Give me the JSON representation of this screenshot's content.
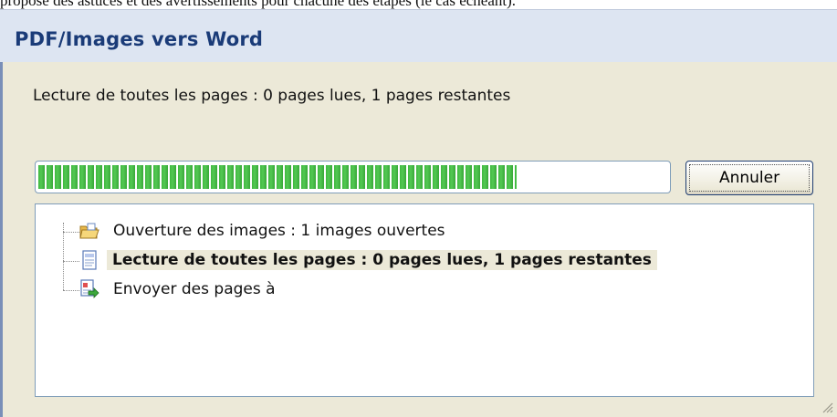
{
  "caption": {
    "text": "propose des astuces et des avertissements pour chacune des étapes (le cas échéant)."
  },
  "window": {
    "title": "PDF/Images vers Word",
    "status": "Lecture de toutes les pages : 0 pages lues, 1 pages restantes",
    "progress": 0.76,
    "cancel_label": "Annuler"
  },
  "tree": {
    "items": [
      {
        "label": "Ouverture des images : 1 images ouvertes",
        "icon": "folder-open-icon",
        "selected": false
      },
      {
        "label": "Lecture de toutes les pages : 0 pages lues, 1 pages restantes",
        "icon": "page-icon",
        "selected": true
      },
      {
        "label": "Envoyer des pages à",
        "icon": "send-document-icon",
        "selected": false
      }
    ]
  },
  "colors": {
    "progress_green": "#3fb83f",
    "title_blue": "#1a3b78",
    "selection_bg": "#ece9d8"
  }
}
